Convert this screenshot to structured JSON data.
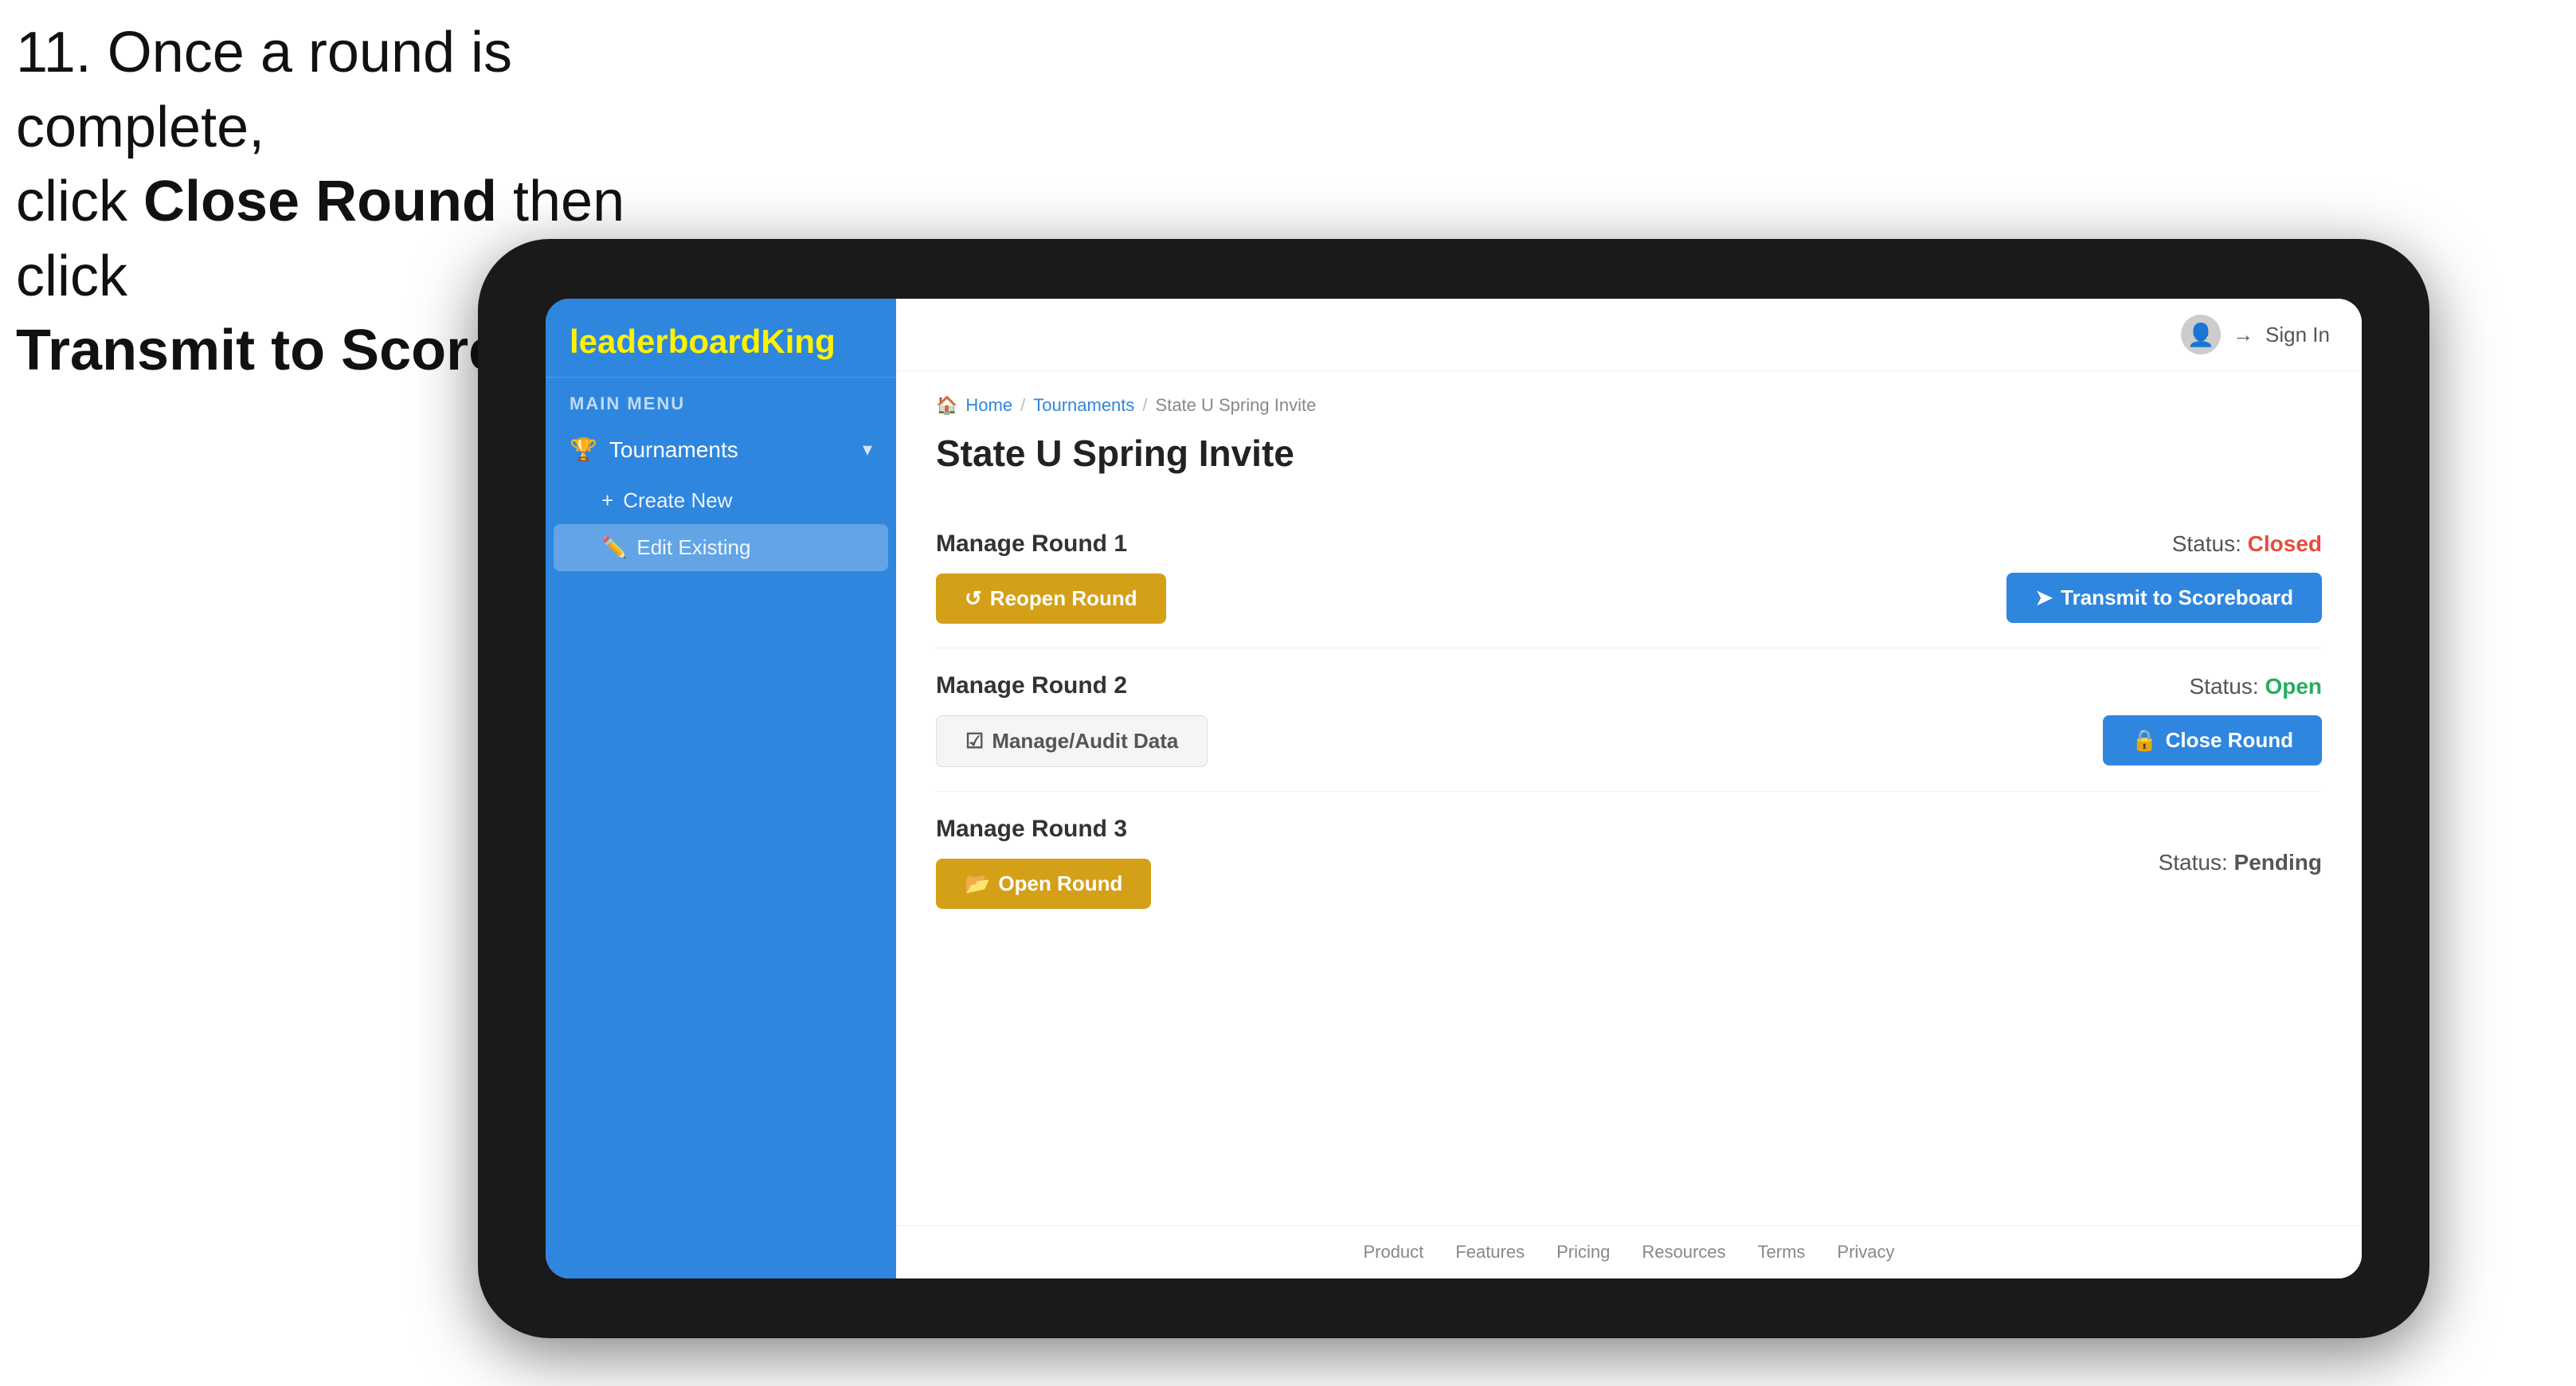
{
  "instruction": {
    "line1": "11. Once a round is complete,",
    "line2": "click ",
    "bold1": "Close Round",
    "line3": " then click",
    "bold2": "Transmit to Scoreboard."
  },
  "logo": {
    "prefix": "leaderboard",
    "suffix": "King"
  },
  "sidebar": {
    "main_menu_label": "MAIN MENU",
    "tournaments_label": "Tournaments",
    "create_new_label": "Create New",
    "edit_existing_label": "Edit Existing"
  },
  "topnav": {
    "sign_in_label": "Sign In"
  },
  "breadcrumb": {
    "home": "Home",
    "tournaments": "Tournaments",
    "current": "State U Spring Invite"
  },
  "page": {
    "title": "State U Spring Invite"
  },
  "rounds": [
    {
      "id": "round1",
      "title": "Manage Round 1",
      "status_label": "Status:",
      "status_value": "Closed",
      "status_class": "status-closed",
      "primary_btn_label": "Reopen Round",
      "primary_btn_style": "btn-gold",
      "secondary_btn_label": "Transmit to Scoreboard",
      "secondary_btn_style": "btn-blue"
    },
    {
      "id": "round2",
      "title": "Manage Round 2",
      "status_label": "Status:",
      "status_value": "Open",
      "status_class": "status-open",
      "primary_btn_label": "Manage/Audit Data",
      "primary_btn_style": "btn-outline-checkbox",
      "secondary_btn_label": "Close Round",
      "secondary_btn_style": "btn-blue"
    },
    {
      "id": "round3",
      "title": "Manage Round 3",
      "status_label": "Status:",
      "status_value": "Pending",
      "status_class": "status-pending",
      "primary_btn_label": "Open Round",
      "primary_btn_style": "btn-gold",
      "secondary_btn_label": null,
      "secondary_btn_style": null
    }
  ],
  "footer": {
    "links": [
      "Product",
      "Features",
      "Pricing",
      "Resources",
      "Terms",
      "Privacy"
    ]
  },
  "icons": {
    "trophy": "🏆",
    "plus": "+",
    "edit": "✏️",
    "chevron_down": "▾",
    "user": "👤",
    "signin_arrow": "→",
    "reopen": "↺",
    "transmit": "➤",
    "audit": "☑",
    "close": "🔒",
    "open": "📂",
    "home": "🏠"
  }
}
